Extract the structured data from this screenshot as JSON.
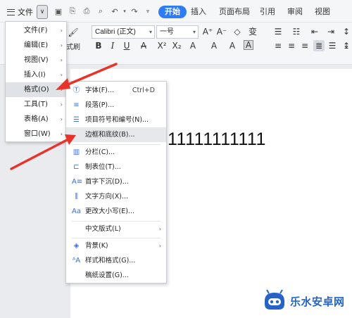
{
  "toolbar": {
    "menu_label": "文件",
    "tabs": [
      "开始",
      "插入",
      "页面布局",
      "引用",
      "审阅",
      "视图"
    ]
  },
  "ribbon": {
    "font_name": "Calibri (正文)",
    "font_size": "一号",
    "paste_label": "式刷"
  },
  "main_menu": {
    "items": [
      {
        "label": "文件(F)"
      },
      {
        "label": "编辑(E)"
      },
      {
        "label": "视图(V)"
      },
      {
        "label": "插入(I)"
      },
      {
        "label": "格式(O)"
      },
      {
        "label": "工具(T)"
      },
      {
        "label": "表格(A)"
      },
      {
        "label": "窗口(W)"
      }
    ]
  },
  "sub_menu": {
    "items": [
      {
        "label": "字体(F)...",
        "shortcut": "Ctrl+D",
        "icon": "font-icon"
      },
      {
        "label": "段落(P)...",
        "icon": "paragraph-icon"
      },
      {
        "label": "项目符号和编号(N)...",
        "icon": "bullets-icon"
      },
      {
        "label": "边框和底纹(B)...",
        "icon": ""
      },
      {
        "label": "分栏(C)...",
        "icon": "columns-icon"
      },
      {
        "label": "制表位(T)...",
        "icon": "tabstop-icon"
      },
      {
        "label": "首字下沉(D)...",
        "icon": "dropcap-icon"
      },
      {
        "label": "文字方向(X)...",
        "icon": "text-direction-icon"
      },
      {
        "label": "更改大小写(E)...",
        "icon": "change-case-icon"
      },
      {
        "label": "中文版式(L)",
        "icon": ""
      },
      {
        "label": "背景(K)",
        "icon": "background-icon"
      },
      {
        "label": "样式和格式(G)...",
        "icon": "styles-icon"
      },
      {
        "label": "稿纸设置(G)...",
        "icon": ""
      }
    ]
  },
  "document": {
    "text": "11111111111"
  },
  "watermark": {
    "text": "乐水安卓网"
  },
  "colors": {
    "accent": "#2f7cf6",
    "arrow": "#e8332a",
    "watermark": "#2563c8"
  }
}
